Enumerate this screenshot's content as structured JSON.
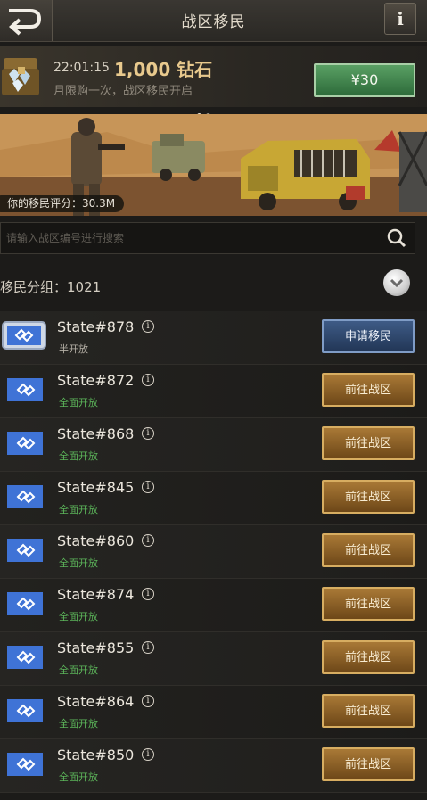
{
  "header": {
    "title": "战区移民",
    "back_icon": "back-arrow-icon",
    "info_label": "i"
  },
  "offer": {
    "time": "22:01:15",
    "amount": "1,000 钻石",
    "description": "月限购一次，战区移民开启",
    "price": "¥30",
    "price_color": "#3f8a4c"
  },
  "banner": {
    "score_label": "你的移民评分：30.3M"
  },
  "search": {
    "placeholder": "请输入战区编号进行搜索",
    "value": ""
  },
  "group": {
    "label": "移民分组：1021"
  },
  "states": [
    {
      "name": "State#878",
      "status": "半开放",
      "button": "申请移民"
    },
    {
      "name": "State#872",
      "status": "全面开放",
      "button": "前往战区"
    },
    {
      "name": "State#868",
      "status": "全面开放",
      "button": "前往战区"
    },
    {
      "name": "State#845",
      "status": "全面开放",
      "button": "前往战区"
    },
    {
      "name": "State#860",
      "status": "全面开放",
      "button": "前往战区"
    },
    {
      "name": "State#874",
      "status": "全面开放",
      "button": "前往战区"
    },
    {
      "name": "State#855",
      "status": "全面开放",
      "button": "前往战区"
    },
    {
      "name": "State#864",
      "status": "全面开放",
      "button": "前往战区"
    },
    {
      "name": "State#850",
      "status": "全面开放",
      "button": "前往战区"
    }
  ],
  "colors": {
    "status_open": "#5cb55a",
    "go_button": "#8a5e26",
    "apply_button": "#2f4a72"
  }
}
